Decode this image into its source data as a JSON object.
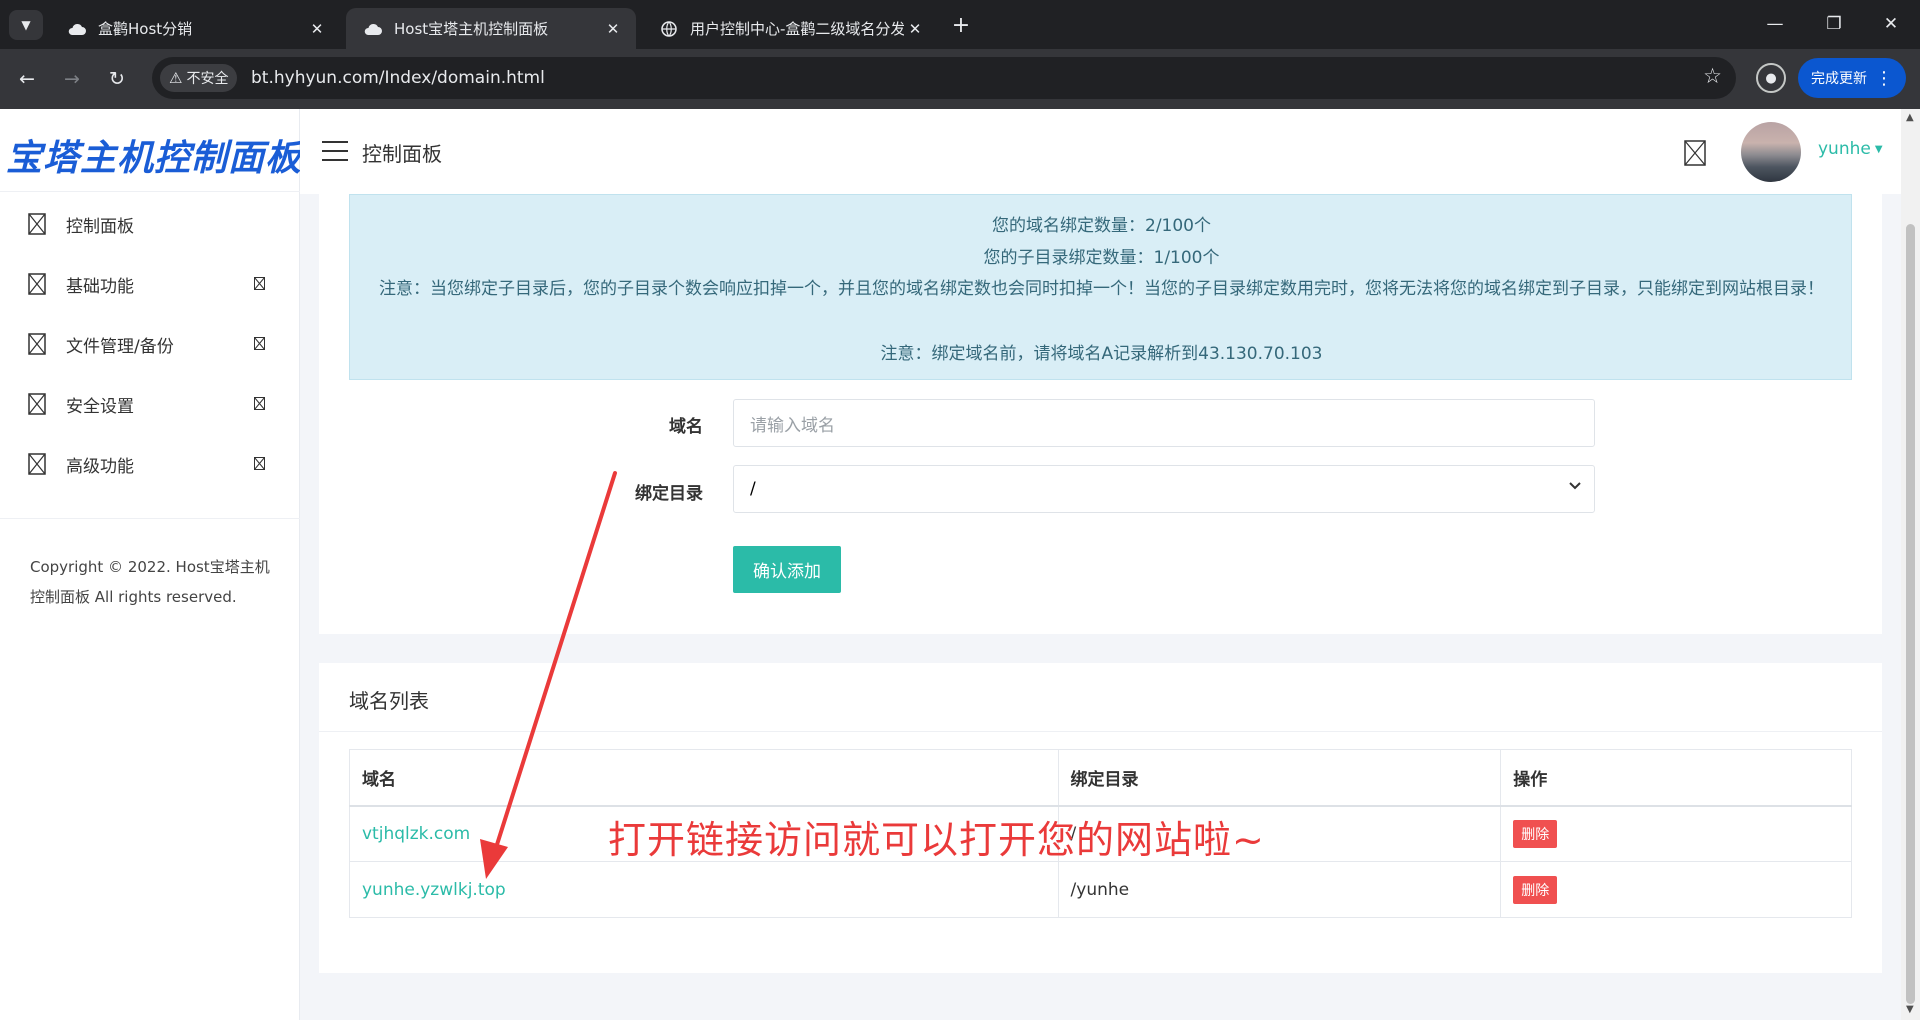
{
  "browser": {
    "tabs": [
      {
        "title": "盒鹳Host分销",
        "active": false
      },
      {
        "title": "Host宝塔主机控制面板",
        "active": true
      },
      {
        "title": "用户控制中心-盒鹳二级域名分发",
        "active": false
      }
    ],
    "security_label": "不安全",
    "url": "bt.hyhyun.com/Index/domain.html",
    "update_label": "完成更新"
  },
  "sidebar": {
    "brand": "宝塔主机控制面板",
    "items": [
      {
        "label": "控制面板",
        "has_submenu": false
      },
      {
        "label": "基础功能",
        "has_submenu": true
      },
      {
        "label": "文件管理/备份",
        "has_submenu": true
      },
      {
        "label": "安全设置",
        "has_submenu": true
      },
      {
        "label": "高级功能",
        "has_submenu": true
      }
    ],
    "copyright": "Copyright © 2022. Host宝塔主机控制面板 All rights reserved."
  },
  "topbar": {
    "title": "控制面板",
    "username": "yunhe"
  },
  "notice": {
    "lines": [
      "您的域名绑定数量：2/100个",
      "您的子目录绑定数量：1/100个",
      "注意：当您绑定子目录后，您的子目录个数会响应扣掉一个，并且您的域名绑定数也会同时扣掉一个！当您的子目录绑定数用完时，您将无法将您的域名绑定到子目录，只能绑定到网站根目录！",
      "注意：绑定域名前，请将域名A记录解析到43.130.70.103"
    ]
  },
  "form": {
    "domain_label": "域名",
    "domain_placeholder": "请输入域名",
    "dir_label": "绑定目录",
    "dir_value": "/",
    "submit_label": "确认添加"
  },
  "domain_list": {
    "title": "域名列表",
    "columns": [
      "域名",
      "绑定目录",
      "操作"
    ],
    "rows": [
      {
        "domain": "vtjhqlzk.com",
        "dir": "/",
        "action": "删除"
      },
      {
        "domain": "yunhe.yzwlkj.top",
        "dir": "/yunhe",
        "action": "删除"
      }
    ]
  },
  "annotation": {
    "text": "打开链接访问就可以打开您的网站啦~",
    "color": "#ea3a3a"
  },
  "colors": {
    "accent": "#2bbba8",
    "brand": "#1a5dd6",
    "danger": "#f05050",
    "notice_bg": "#d9eef6"
  }
}
